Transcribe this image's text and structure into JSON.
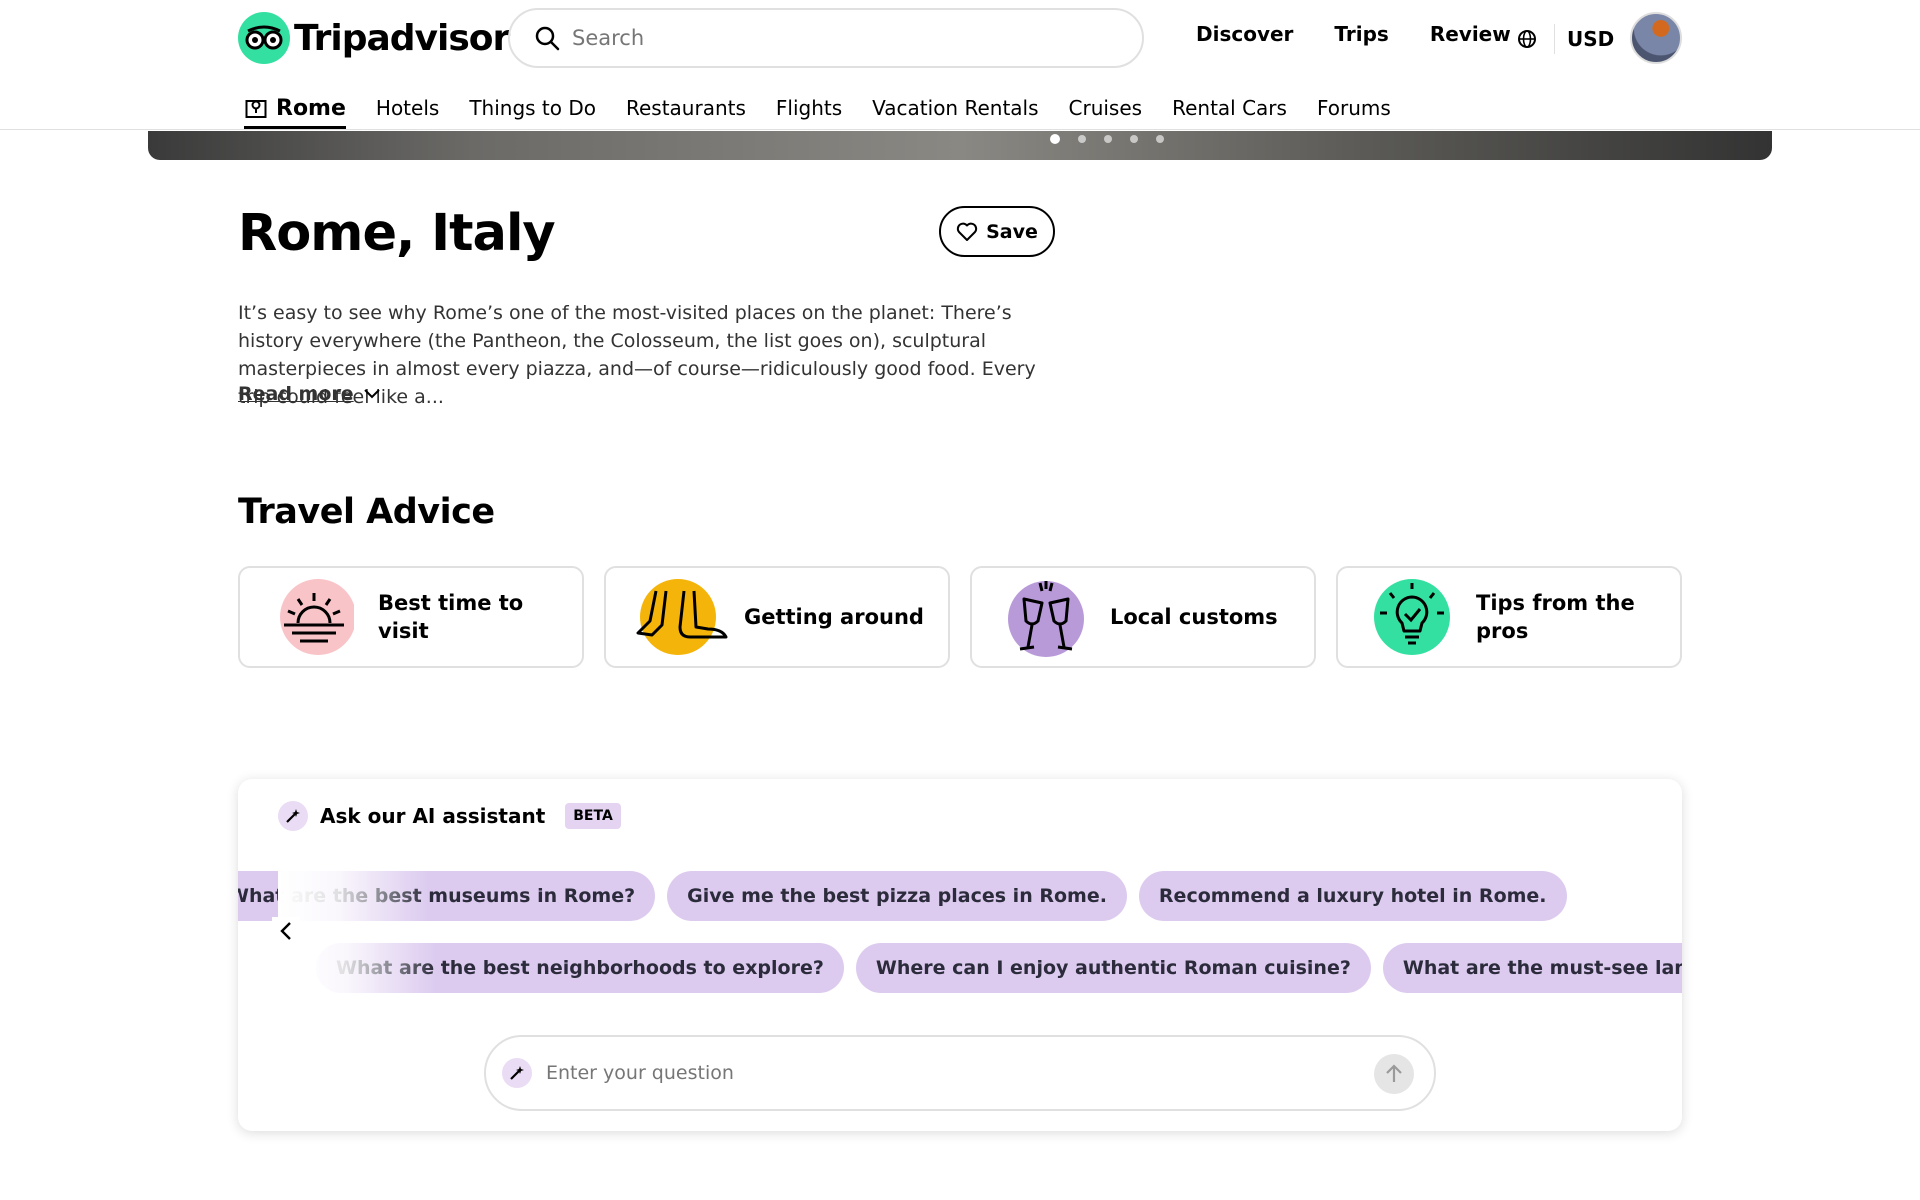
{
  "brand": {
    "name": "Tripadvisor",
    "accent": "#34e0a1"
  },
  "search": {
    "placeholder": "Search"
  },
  "top_nav": {
    "discover": "Discover",
    "trips": "Trips",
    "review": "Review",
    "currency": "USD"
  },
  "sub_nav": {
    "items": [
      {
        "label": "Rome",
        "active": true
      },
      {
        "label": "Hotels"
      },
      {
        "label": "Things to Do"
      },
      {
        "label": "Restaurants"
      },
      {
        "label": "Flights"
      },
      {
        "label": "Vacation Rentals"
      },
      {
        "label": "Cruises"
      },
      {
        "label": "Rental Cars"
      },
      {
        "label": "Forums"
      }
    ]
  },
  "hero": {
    "slides": 5,
    "active_slide": 1
  },
  "page": {
    "title": "Rome, Italy",
    "save_label": "Save",
    "description": "It’s easy to see why Rome’s one of the most-visited places on the planet: There’s history everywhere (the Pantheon, the Colosseum, the list goes on), sculptural masterpieces in almost every piazza, and—of course—ridiculously good food. Every trip could feel like a...",
    "read_more": "Read more"
  },
  "travel_advice": {
    "title": "Travel Advice",
    "cards": [
      {
        "label": "Best time to visit",
        "icon": "sunrise-icon",
        "color": "#f9c4c8"
      },
      {
        "label": "Getting around",
        "icon": "feet-icon",
        "color": "#f5b40a"
      },
      {
        "label": "Local customs",
        "icon": "cheers-glasses-icon",
        "color": "#b89ad9"
      },
      {
        "label": "Tips from the pros",
        "icon": "lightbulb-icon",
        "color": "#34e0a1"
      }
    ]
  },
  "ai_assistant": {
    "title": "Ask our AI assistant",
    "badge": "BETA",
    "suggestions_row1": [
      "What are the best museums in Rome?",
      "Give me the best pizza places in Rome.",
      "Recommend a luxury hotel in Rome."
    ],
    "suggestions_row2": [
      "What are the best neighborhoods to explore?",
      "Where can I enjoy authentic Roman cuisine?",
      "What are the must-see landmarks in Rome?"
    ],
    "input_placeholder": "Enter your question",
    "chip_color": "#dccbef"
  }
}
